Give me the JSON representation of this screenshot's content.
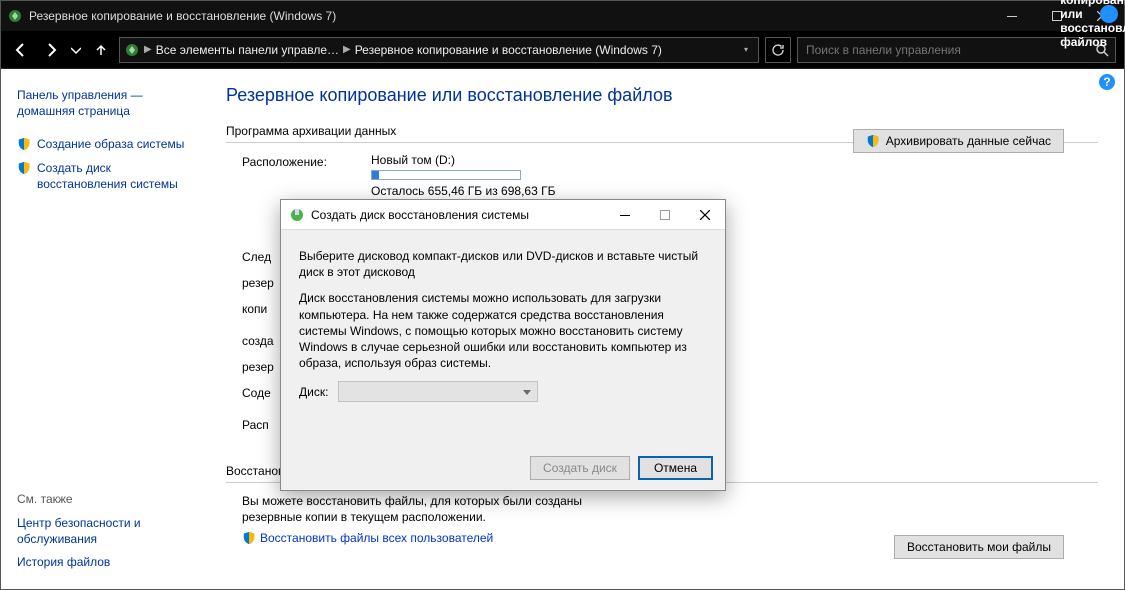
{
  "window": {
    "title": "Резервное копирование и восстановление (Windows 7)"
  },
  "breadcrumb": {
    "seg1": "Все элементы панели управле…",
    "seg2": "Резервное копирование и восстановление (Windows 7)"
  },
  "search": {
    "placeholder": "Поиск в панели управления"
  },
  "sidebar": {
    "home_line1": "Панель управления —",
    "home_line2": "домашняя страница",
    "tasks": [
      {
        "label": "Создание образа системы"
      },
      {
        "label": "Создать диск восстановления системы"
      }
    ],
    "see_also_header": "См. также",
    "see_also": [
      {
        "label": "Центр безопасности и обслуживания"
      },
      {
        "label": "История файлов"
      }
    ]
  },
  "content": {
    "heading": "Резервное копирование или восстановление файлов",
    "group1": "Программа архивации данных",
    "location_label": "Расположение:",
    "volume_name": "Новый том (D:)",
    "free_space": "Осталось 655,46 ГБ из 698,63 ГБ",
    "archive_now": "Архивировать данные сейчас",
    "trunc_rows": [
      "След",
      "резер",
      "копи",
      "созда",
      "резер",
      "Соде",
      "Расп"
    ],
    "group2": "Восстановление",
    "restore_text": "Вы можете восстановить файлы, для которых были созданы резервные копии в текущем расположении.",
    "restore_all_link": "Восстановить файлы всех пользователей",
    "restore_my_files": "Восстановить мои файлы"
  },
  "dialog": {
    "title": "Создать диск восстановления системы",
    "instruction": "Выберите дисковод компакт-дисков или DVD-дисков и вставьте чистый диск в этот дисковод",
    "description": "Диск восстановления системы можно использовать для загрузки компьютера. На нем также содержатся средства восстановления системы Windows, с помощью которых можно восстановить систему Windows в случае серьезной ошибки или восстановить компьютер из образа, используя образ системы.",
    "drive_label": "Диск:",
    "create_button": "Создать диск",
    "cancel_button": "Отмена"
  },
  "help_char": "?"
}
